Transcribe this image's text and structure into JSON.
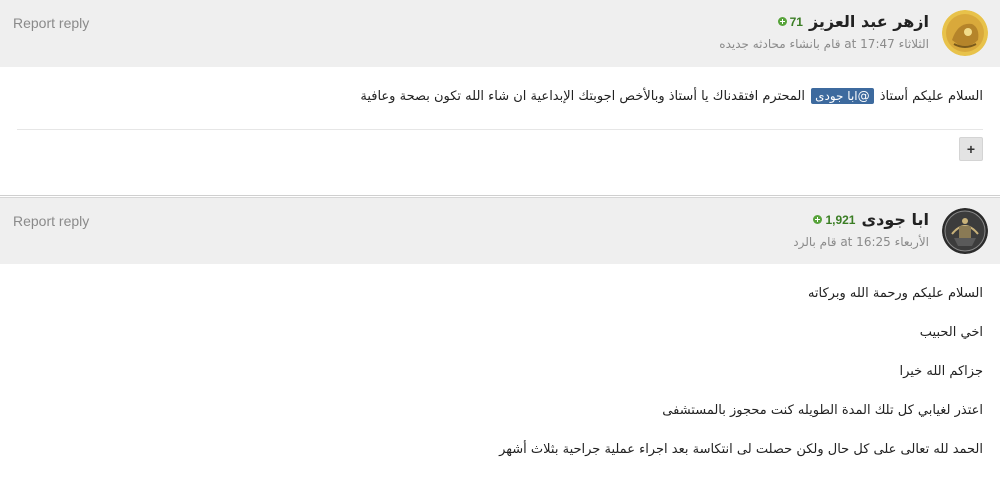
{
  "posts": [
    {
      "report_label": "Report reply",
      "author": "ازهر عبد العزيز",
      "reputation": "71",
      "meta": "الثلاثاء at 17:47 قام بانشاء محادثه جديده",
      "body": {
        "before_mention": "السلام عليكم أستاذ",
        "mention": "@ابا جودى",
        "after_mention": "المحترم افتقدناك يا أستاذ وبالأخص اجوبتك الإبداعية ان شاء الله تكون بصحة وعافية"
      },
      "expand_label": "+"
    },
    {
      "report_label": "Report reply",
      "author": "ابا جودى",
      "reputation": "1,921",
      "meta": "الأربعاء at 16:25 قام بالرد",
      "lines": [
        "السلام عليكم ورحمة الله وبركاته",
        "اخي الحبيب",
        "جزاكم الله خيرا",
        "اعتذر لغيابي كل تلك المدة الطويله كنت محجوز بالمستشفى",
        "الحمد لله تعالى على كل حال ولكن حصلت لى انتكاسة بعد اجراء عملية جراحية بثلاث أشهر"
      ]
    }
  ],
  "colors": {
    "header_bg": "#efefef",
    "mention_bg": "#3d6a9e",
    "reputation_green": "#3a7d24"
  },
  "icons": [
    "reputation-plus-icon",
    "avatar-image"
  ]
}
